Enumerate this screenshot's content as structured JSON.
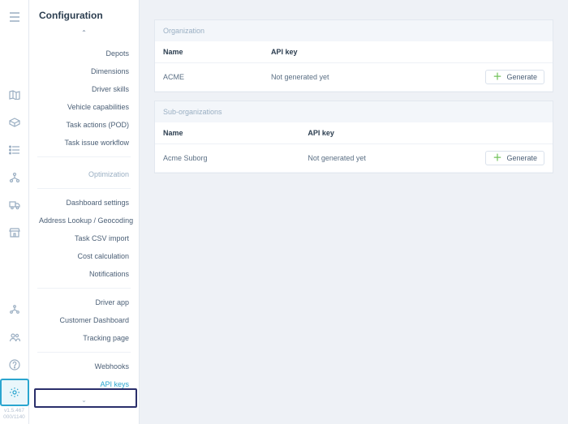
{
  "pageTitle": "Configuration",
  "version": {
    "line1": "v1.5.467",
    "line2": "000/1140"
  },
  "sidebar": {
    "items": [
      {
        "label": "Depots"
      },
      {
        "label": "Dimensions"
      },
      {
        "label": "Driver skills"
      },
      {
        "label": "Vehicle capabilities"
      },
      {
        "label": "Task actions (POD)"
      },
      {
        "label": "Task issue workflow"
      }
    ],
    "optHeader": "Optimization",
    "group2": [
      {
        "label": "Dashboard settings"
      },
      {
        "label": "Address Lookup / Geocoding"
      },
      {
        "label": "Task CSV import"
      },
      {
        "label": "Cost calculation"
      },
      {
        "label": "Notifications"
      }
    ],
    "group3": [
      {
        "label": "Driver app"
      },
      {
        "label": "Customer Dashboard"
      },
      {
        "label": "Tracking page"
      }
    ],
    "group4": [
      {
        "label": "Webhooks"
      },
      {
        "label": "API keys",
        "active": true
      }
    ]
  },
  "sections": {
    "orgTitle": "Organization",
    "subTitle": "Sub-organizations",
    "colName": "Name",
    "colKey": "API key",
    "org": {
      "name": "ACME",
      "key": "Not generated yet"
    },
    "subs": [
      {
        "name": "Acme Suborg",
        "key": "Not generated yet"
      }
    ],
    "generateLabel": "Generate"
  }
}
